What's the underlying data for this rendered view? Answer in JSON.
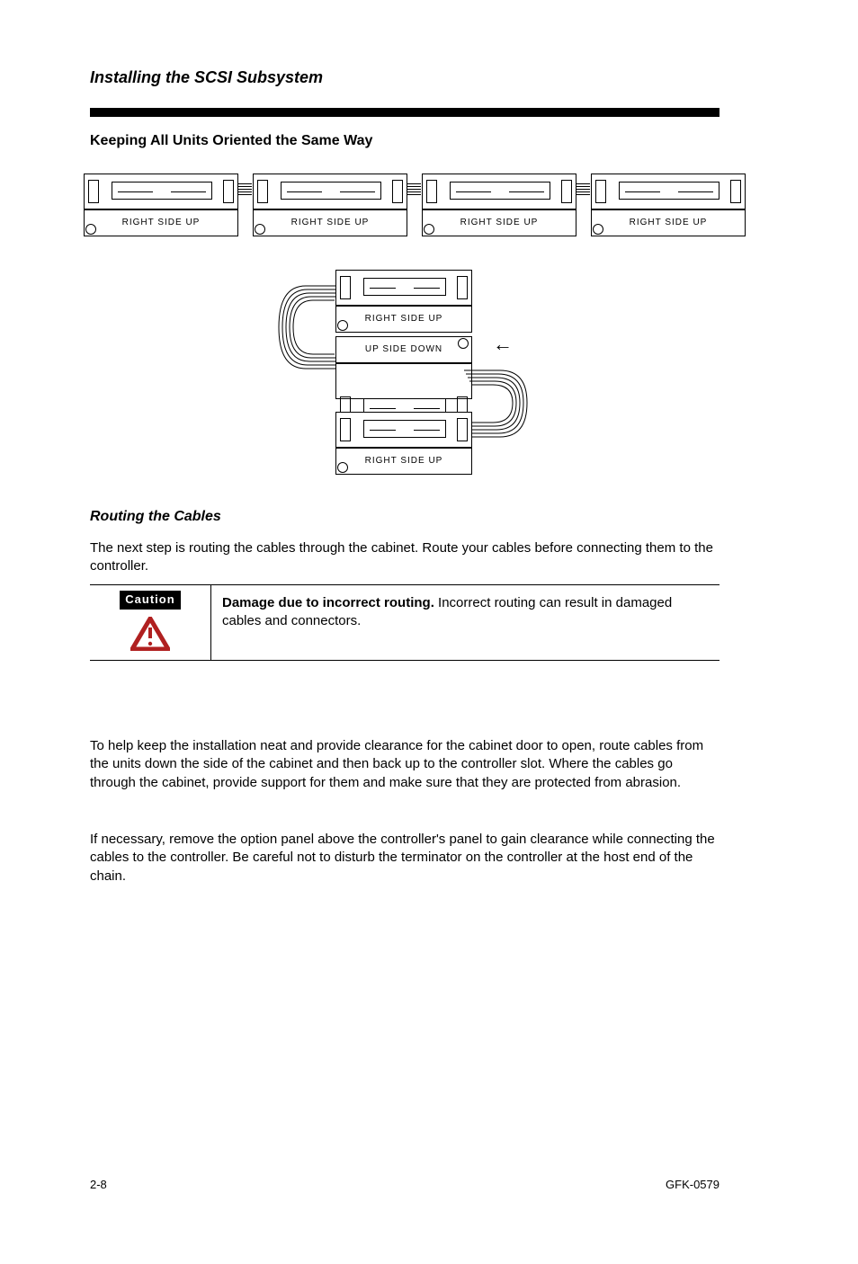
{
  "chapter": "Installing the SCSI Subsystem",
  "section_title": "Keeping All Units Oriented the Same Way",
  "routing": {
    "heading": "Routing the Cables",
    "intro": "The next step is routing the cables through the cabinet. Route your cables before connecting them to the controller.",
    "caution_label": "Caution",
    "caution_head": "Damage due to incorrect routing.",
    "caution_body": "Incorrect routing can result in damaged cables and connectors.",
    "para1": "To help keep the installation neat and provide clearance for the cabinet door to open, route cables from the units down the side of the cabinet and then back up to the controller slot. Where the cables go through the cabinet, provide support for them and make sure that they are protected from abrasion.",
    "para2": "If necessary, remove the option panel above the controller's panel to gain clearance while connecting the cables to the controller. Be careful not to disturb the terminator on the controller at the host end of the chain."
  },
  "diagram": {
    "row_labels": [
      "RIGHT SIDE UP",
      "RIGHT SIDE UP",
      "RIGHT SIDE UP",
      "RIGHT SIDE UP"
    ],
    "stack_labels": [
      "RIGHT SIDE UP",
      "UP SIDE DOWN",
      "",
      "RIGHT SIDE UP"
    ]
  },
  "footer": {
    "page": "2-8",
    "doc": "GFK-0579"
  }
}
